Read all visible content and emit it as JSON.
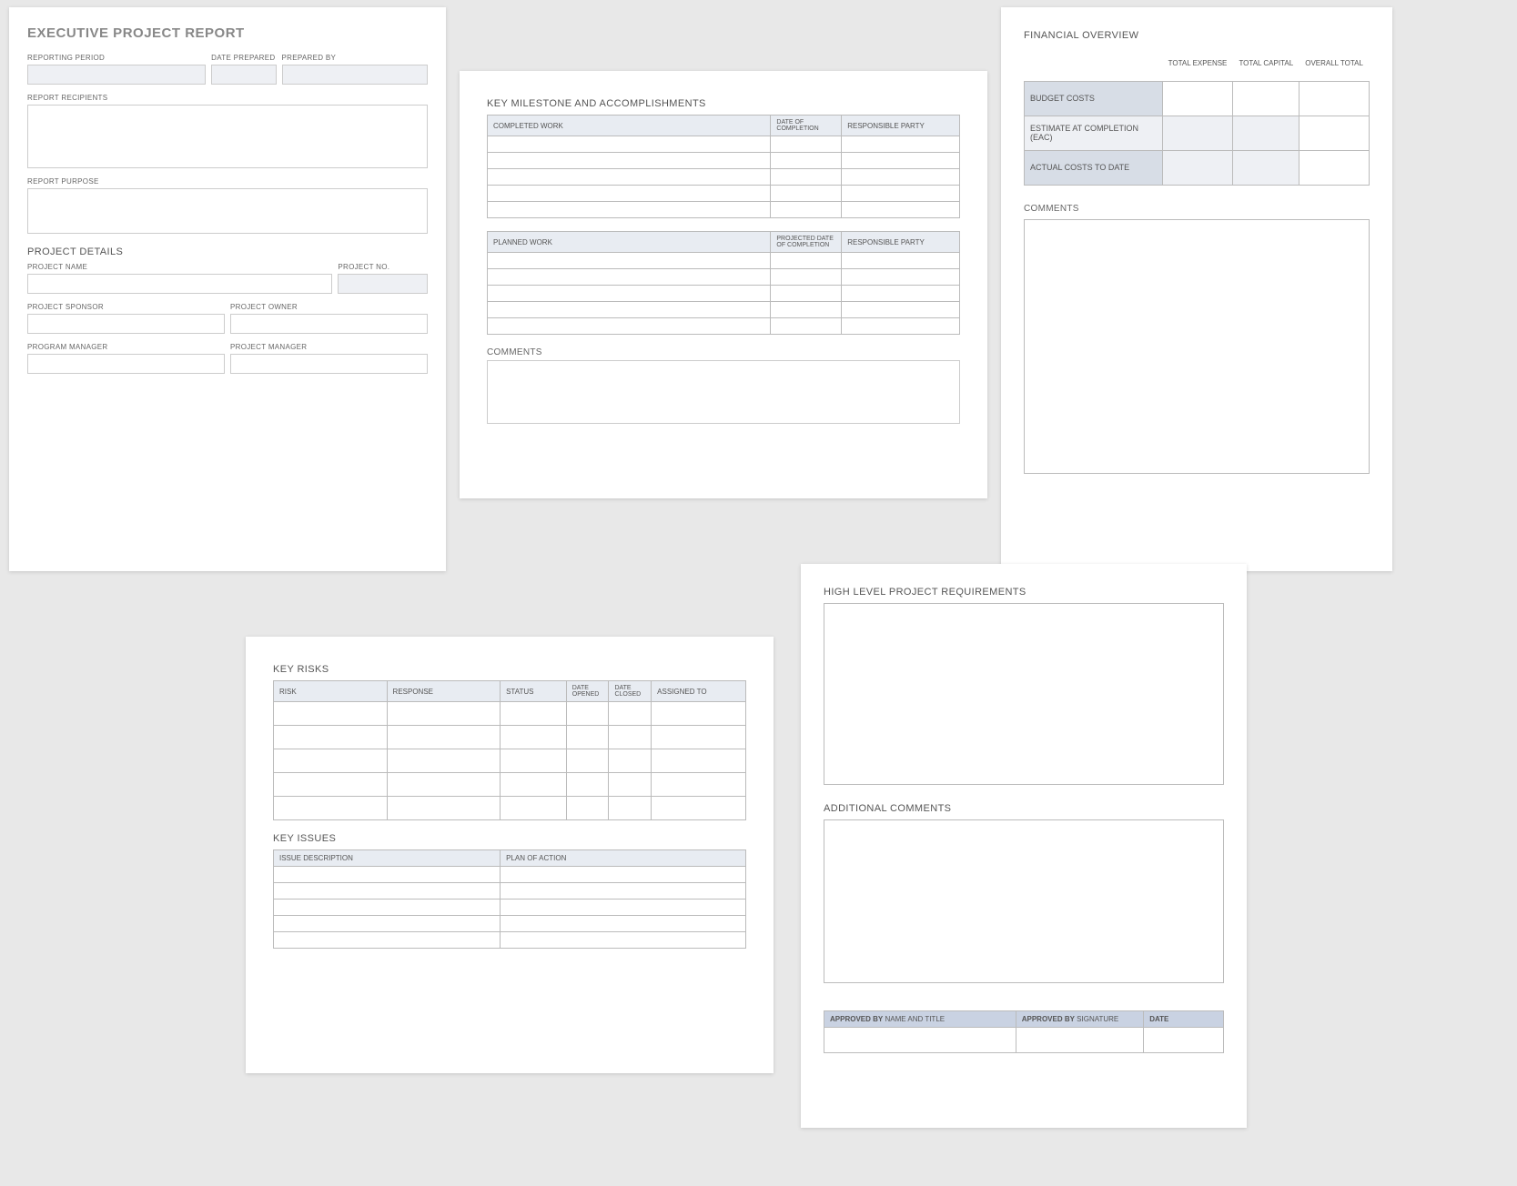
{
  "p1": {
    "title": "EXECUTIVE PROJECT REPORT",
    "reporting_period": "REPORTING PERIOD",
    "date_prepared": "DATE PREPARED",
    "prepared_by": "PREPARED BY",
    "report_recipients": "REPORT RECIPIENTS",
    "report_purpose": "REPORT PURPOSE",
    "project_details": "PROJECT DETAILS",
    "project_name": "PROJECT NAME",
    "project_no": "PROJECT NO.",
    "project_sponsor": "PROJECT SPONSOR",
    "project_owner": "PROJECT OWNER",
    "program_manager": "PROGRAM MANAGER",
    "project_manager": "PROJECT MANAGER"
  },
  "p2": {
    "heading": "KEY MILESTONE AND ACCOMPLISHMENTS",
    "completed_work": "COMPLETED WORK",
    "date_of_completion": "DATE OF COMPLETION",
    "responsible_party": "RESPONSIBLE PARTY",
    "planned_work": "PLANNED WORK",
    "projected_date": "PROJECTED DATE OF COMPLETION",
    "comments": "COMMENTS"
  },
  "p3": {
    "heading": "FINANCIAL OVERVIEW",
    "total_expense": "TOTAL EXPENSE",
    "total_capital": "TOTAL CAPITAL",
    "overall_total": "OVERALL TOTAL",
    "budget_costs": "BUDGET COSTS",
    "eac": "ESTIMATE AT COMPLETION (EAC)",
    "actual_costs": "ACTUAL COSTS TO DATE",
    "comments": "COMMENTS"
  },
  "p4": {
    "risks_h": "KEY RISKS",
    "risk": "RISK",
    "response": "RESPONSE",
    "status": "STATUS",
    "date_opened": "DATE OPENED",
    "date_closed": "DATE CLOSED",
    "assigned_to": "ASSIGNED TO",
    "issues_h": "KEY ISSUES",
    "issue_desc": "ISSUE DESCRIPTION",
    "plan_action": "PLAN OF ACTION"
  },
  "p5": {
    "req_h": "HIGH LEVEL PROJECT REQUIREMENTS",
    "add_h": "ADDITIONAL COMMENTS",
    "approved_by_strong": "APPROVED BY",
    "name_title": " NAME AND TITLE",
    "signature": " SIGNATURE",
    "date": "DATE"
  }
}
